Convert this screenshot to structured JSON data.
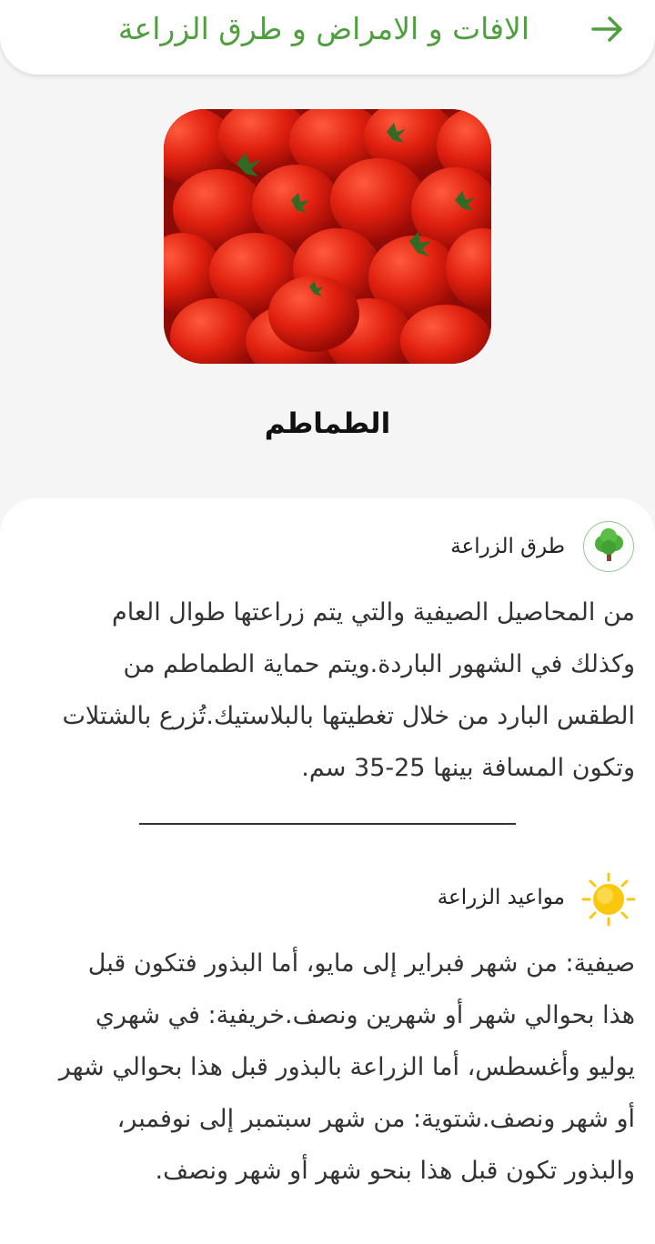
{
  "header": {
    "title": "الافات و الامراض و طرق الزراعة"
  },
  "crop": {
    "name": "الطماطم"
  },
  "planting_methods": {
    "title": "طرق الزراعة",
    "lines": [
      "من المحاصيل الصيفية والتي يتم زراعتها طوال العام",
      "وكذلك في الشهور الباردة.ويتم حماية الطماطم من",
      "الطقس البارد من خلال تغطيتها بالبلاستيك.تُزرع بالشتلات",
      "وتكون المسافة بينها 25-35 سم."
    ]
  },
  "planting_dates": {
    "title": "مواعيد الزراعة",
    "lines": [
      "صيفية: من شهر فبراير إلى مايو، أما البذور فتكون قبل",
      "هذا بحوالي شهر أو شهرين ونصف.خريفية: في شهري",
      "يوليو وأغسطس، أما الزراعة بالبذور قبل هذا بحوالي شهر",
      "أو شهر ونصف.شتوية: من شهر سبتمبر إلى نوفمبر،",
      "والبذور تكون قبل هذا بنحو شهر أو شهر ونصف."
    ]
  },
  "icons": {
    "back": "arrow-right-icon",
    "methods": "tree-icon",
    "dates": "sun-icon"
  },
  "colors": {
    "accent": "#4f9f3f",
    "sun": "#f9c80e",
    "tomato": "#d8180f"
  }
}
